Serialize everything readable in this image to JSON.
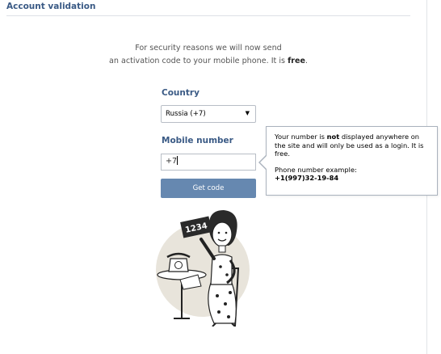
{
  "page": {
    "title": "Account validation"
  },
  "intro": {
    "line1": "For security reasons we will now send",
    "line2_prefix": "an activation code to your mobile phone. It is ",
    "line2_bold": "free",
    "line2_suffix": "."
  },
  "form": {
    "country_label": "Country",
    "country_value": "Russia (+7)",
    "mobile_label": "Mobile number",
    "phone_value": "+7",
    "get_code_label": "Get code"
  },
  "tooltip": {
    "text_prefix": "Your number is ",
    "text_bold": "not",
    "text_suffix": " displayed anywhere on the site and will only be used as a login. It is free.",
    "example_label": "Phone number example:",
    "example_number": "+1(997)32-19-84"
  },
  "illustration": {
    "card_number": "1234"
  },
  "colors": {
    "accent": "#3a5a85",
    "button": "#6688b0",
    "circle": "#e8e4db"
  }
}
